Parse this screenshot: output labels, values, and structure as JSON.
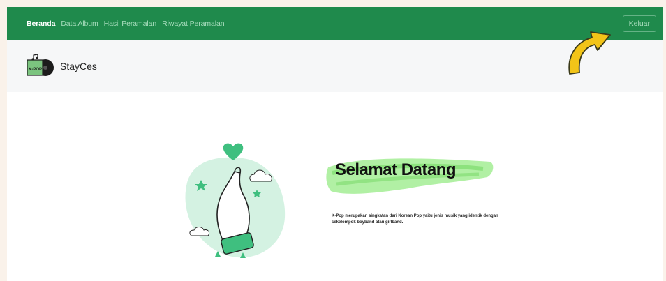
{
  "nav": {
    "links": [
      {
        "label": "Beranda",
        "active": true
      },
      {
        "label": "Data Album",
        "active": false
      },
      {
        "label": "Hasil Peramalan",
        "active": false
      },
      {
        "label": "Riwayat Peramalan",
        "active": false
      }
    ],
    "logout_label": "Keluar"
  },
  "brand": {
    "logo_text": "K-POP",
    "name": "StayCes"
  },
  "hero": {
    "title": "Selamat Datang",
    "description": "K-Pop merupakan singkatan dari Korean Pop yaitu jenis musik yang identik dengan sekelompok boyband atau girlband."
  },
  "colors": {
    "nav_bg": "#1f8a4c",
    "nav_inactive_text": "#a7dcbc",
    "brandbar_bg": "#f6f7f8",
    "accent_green": "#6ee07a",
    "arrow_yellow": "#f2c418"
  }
}
